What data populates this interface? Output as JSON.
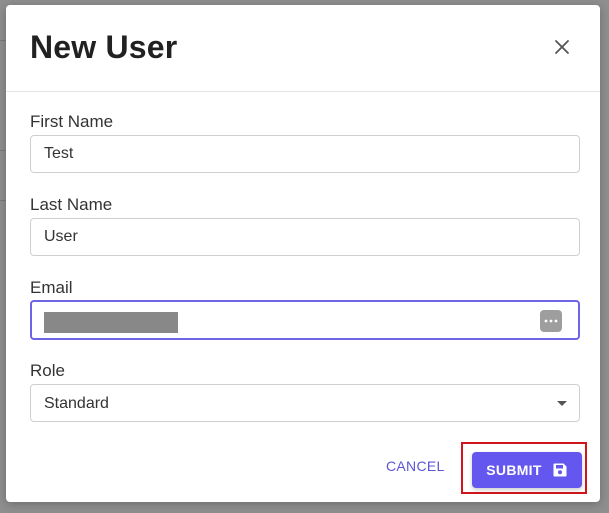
{
  "dialog": {
    "title": "New User",
    "close_icon": "close-icon"
  },
  "form": {
    "first_name": {
      "label": "First Name",
      "value": "Test"
    },
    "last_name": {
      "label": "Last Name",
      "value": "User"
    },
    "email": {
      "label": "Email",
      "value": "",
      "redacted": true,
      "autofill_icon": "more-dots-icon"
    },
    "role": {
      "label": "Role",
      "selected": "Standard",
      "caret_icon": "caret-down-icon"
    }
  },
  "actions": {
    "cancel_label": "CANCEL",
    "submit_label": "SUBMIT",
    "submit_icon": "save-icon"
  },
  "colors": {
    "accent": "#6457f0",
    "focus_border": "#6f63e6",
    "highlight": "#d0161b"
  }
}
